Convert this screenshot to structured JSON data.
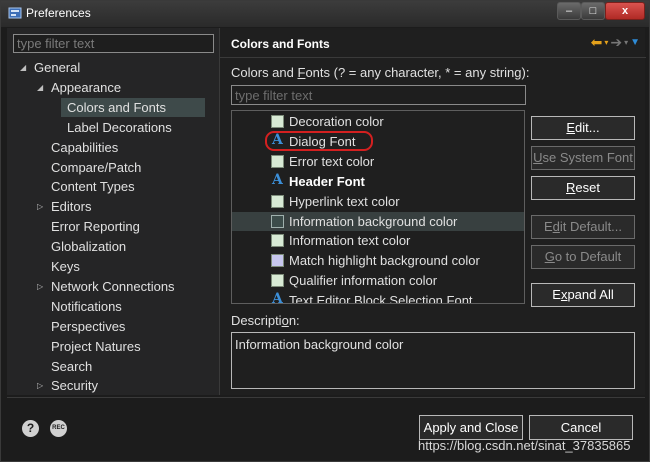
{
  "window": {
    "title": "Preferences",
    "minimize": "‒",
    "maximize": "□",
    "close": "x"
  },
  "left": {
    "filter_placeholder": "type filter text",
    "tree": [
      {
        "label": "General",
        "level": 0,
        "expanded": true
      },
      {
        "label": "Appearance",
        "level": 1,
        "expanded": true
      },
      {
        "label": "Colors and Fonts",
        "level": 2,
        "selected": true
      },
      {
        "label": "Label Decorations",
        "level": 2
      },
      {
        "label": "Capabilities",
        "level": 1
      },
      {
        "label": "Compare/Patch",
        "level": 1
      },
      {
        "label": "Content Types",
        "level": 1
      },
      {
        "label": "Editors",
        "level": 1,
        "collapsed": true
      },
      {
        "label": "Error Reporting",
        "level": 1
      },
      {
        "label": "Globalization",
        "level": 1
      },
      {
        "label": "Keys",
        "level": 1
      },
      {
        "label": "Network Connections",
        "level": 1,
        "collapsed": true
      },
      {
        "label": "Notifications",
        "level": 1
      },
      {
        "label": "Perspectives",
        "level": 1
      },
      {
        "label": "Project Natures",
        "level": 1
      },
      {
        "label": "Search",
        "level": 1
      },
      {
        "label": "Security",
        "level": 1,
        "collapsed": true
      }
    ]
  },
  "right": {
    "title": "Colors and Fonts",
    "list_label_pre": "Colors and ",
    "list_label_mnemonic": "F",
    "list_label_post": "onts (? = any character, * = any string):",
    "filter_placeholder": "type filter text",
    "items": [
      {
        "label": "Decoration color",
        "kind": "color",
        "swatch": "#d8ead5"
      },
      {
        "label": "Dialog Font",
        "kind": "font",
        "circled": true
      },
      {
        "label": "Error text color",
        "kind": "color",
        "swatch": "#d8ead5"
      },
      {
        "label": "Header Font",
        "kind": "font",
        "bold": true
      },
      {
        "label": "Hyperlink text color",
        "kind": "color",
        "swatch": "#d8ead5"
      },
      {
        "label": "Information background color",
        "kind": "color",
        "swatch": "#3c4c4a",
        "selected": true
      },
      {
        "label": "Information text color",
        "kind": "color",
        "swatch": "#d8ead5"
      },
      {
        "label": "Match highlight background color",
        "kind": "color",
        "swatch": "#c7c7ee"
      },
      {
        "label": "Qualifier information color",
        "kind": "color",
        "swatch": "#d8ead5"
      },
      {
        "label": "Text Editor Block Selection Font",
        "kind": "font"
      }
    ],
    "buttons": {
      "edit": {
        "pre": "",
        "mn": "E",
        "post": "dit..."
      },
      "use_system_font": {
        "pre": "",
        "mn": "U",
        "post": "se System Font"
      },
      "reset": {
        "pre": "",
        "mn": "R",
        "post": "eset"
      },
      "edit_default": {
        "pre": "E",
        "mn": "d",
        "post": "it Default..."
      },
      "go_to_default": {
        "pre": "",
        "mn": "G",
        "post": "o to Default"
      },
      "expand_all": {
        "pre": "E",
        "mn": "x",
        "post": "pand All"
      }
    },
    "description_pre": "Descripti",
    "description_mn": "o",
    "description_post": "n:",
    "description_text": "Information background color"
  },
  "bottom": {
    "help_icon": "?",
    "rec_icon": "REC",
    "apply_close": "Apply and Close",
    "cancel": "Cancel"
  },
  "watermark": "https://blog.csdn.net/sinat_37835865",
  "colors": {
    "accent_blue": "#3c8fd8",
    "nav_back": "#e4a11b",
    "highlight_oval": "#d42020",
    "selection_bg": "#3e4a4a"
  }
}
